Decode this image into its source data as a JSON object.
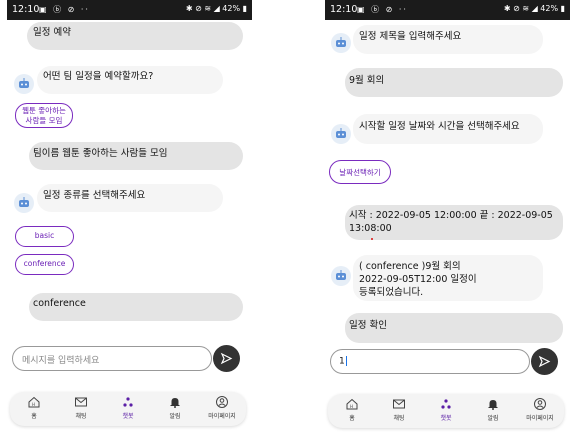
{
  "left": {
    "status": {
      "time": "12:10",
      "battery": "42%"
    },
    "messages": [
      {
        "from": "user",
        "text": "일정 예약"
      },
      {
        "from": "bot",
        "text": "어떤 팀 일정을 예약할까요?"
      },
      {
        "from": "user",
        "text": "팀이름 웹툰 좋아하는 사람들 모임"
      },
      {
        "from": "bot",
        "text": "일정 종류를 선택해주세요"
      },
      {
        "from": "user",
        "text": "conference"
      }
    ],
    "chips": {
      "team_line1": "웹툰 좋아하는",
      "team_line2": "사람들 모임",
      "basic": "basic",
      "conference": "conference"
    },
    "input": {
      "placeholder": "메시지를 입력하세요"
    }
  },
  "right": {
    "status": {
      "time": "12:10",
      "battery": "42%"
    },
    "messages": [
      {
        "from": "bot",
        "text": "일정 제목을 입력해주세요"
      },
      {
        "from": "user",
        "text": "9월 회의"
      },
      {
        "from": "bot",
        "text": "시작할 일정 날짜와 시간을 선택해주세요"
      },
      {
        "from": "user",
        "line1": "시작 : 2022-09-05 12:00:00  끝 : 2022-09-05",
        "line2": "13:08:00"
      },
      {
        "from": "bot",
        "line1": "( conference )9월 회의",
        "line2": "2022-09-05T12:00 일정이",
        "line3": "등록되었습니다."
      },
      {
        "from": "user",
        "text": "일정 확인"
      }
    ],
    "chips": {
      "date": "날짜선택하기"
    },
    "input": {
      "value": "1"
    }
  },
  "nav": {
    "home": "홈",
    "chat": "채팅",
    "chatbot": "챗봇",
    "alarm": "알림",
    "mypage": "마이페이지"
  },
  "colors": {
    "accent": "#6a1fb5",
    "user_bubble": "#e4e4e4",
    "bot_bubble": "#f5f5f5",
    "status_bar": "#1b1b1b"
  },
  "icons": [
    "robot-icon",
    "home-icon",
    "mail-icon",
    "chatbot-icon",
    "bell-icon",
    "person-icon",
    "send-icon",
    "wifi-icon",
    "battery-icon"
  ]
}
